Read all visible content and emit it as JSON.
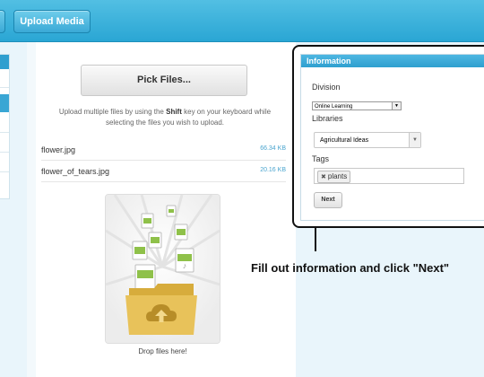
{
  "header": {
    "upload_media_label": "Upload Media"
  },
  "main": {
    "pick_files_label": "Pick Files...",
    "hint_before": "Upload multiple files by using the ",
    "hint_key": "Shift",
    "hint_after": " key on your keyboard while selecting the files you wish to upload.",
    "files": [
      {
        "name": "flower.jpg",
        "size": "66.34 KB"
      },
      {
        "name": "flower_of_tears.jpg",
        "size": "20.16 KB"
      }
    ],
    "drop_label": "Drop files here!"
  },
  "information": {
    "title": "Information",
    "division_label": "Division",
    "division_value": "Online Learning",
    "libraries_label": "Libraries",
    "libraries_value": "Agricultural Ideas",
    "tags_label": "Tags",
    "tags": [
      "plants"
    ],
    "next_label": "Next"
  },
  "annotation": {
    "text": "Fill out information and click \"Next\""
  },
  "colors": {
    "header_blue": "#2aa6d4",
    "accent_blue": "#39a6d4",
    "folder_gold": "#e0b84a"
  }
}
